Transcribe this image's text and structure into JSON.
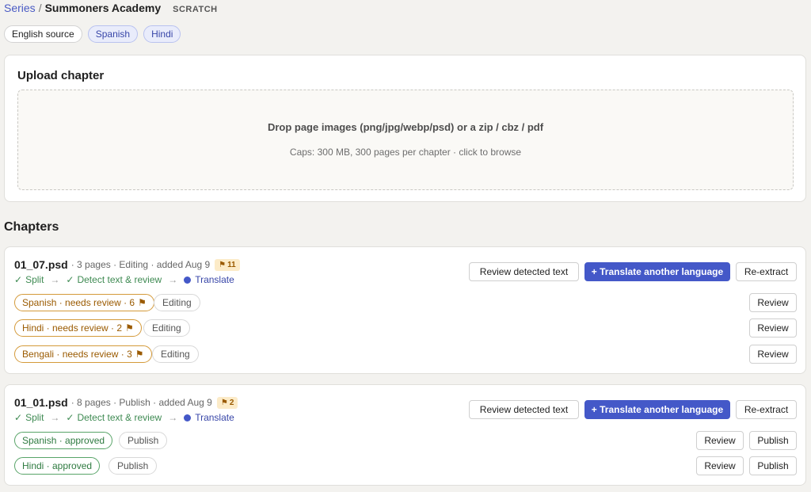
{
  "breadcrumb": {
    "link": "Series",
    "separator": "/",
    "series": "Summoners Academy",
    "tag": "SCRATCH"
  },
  "languages": {
    "source": "English source",
    "targets": [
      "Spanish",
      "Hindi"
    ]
  },
  "upload": {
    "title": "Upload chapter",
    "drop_text": "Drop page images (png/jpg/webp/psd) or a zip / cbz / pdf",
    "caps_text": "Caps: 300 MB, 300 pages per chapter · click to browse"
  },
  "chapters_title": "Chapters",
  "pipeline": {
    "split": "Split",
    "detect": "Detect text & review",
    "translate": "Translate",
    "arrow": "→",
    "check": "✓"
  },
  "buttons": {
    "review_detected": "Review detected text",
    "translate_another": "+ Translate another language",
    "reextract": "Re-extract",
    "review": "Review",
    "publish": "Publish"
  },
  "chapters": [
    {
      "name": "01_07.psd",
      "meta": "· 3 pages · Editing · added Aug 9",
      "flags": "11",
      "rows": [
        {
          "status": "Spanish · needs review · 6",
          "stage": "Editing"
        },
        {
          "status": "Hindi · needs review · 2",
          "stage": "Editing"
        },
        {
          "status": "Bengali · needs review · 3",
          "stage": "Editing"
        }
      ]
    },
    {
      "name": "01_01.psd",
      "meta": "· 8 pages · Publish · added Aug 9",
      "flags": "2",
      "rows": [
        {
          "status": "Spanish · approved",
          "stage": "Publish"
        },
        {
          "status": "Hindi · approved",
          "stage": "Publish"
        }
      ]
    }
  ],
  "icons": {
    "flag": "flag-icon",
    "check": "check-icon",
    "arrow": "arrow-right-icon",
    "current": "current-step-dot-icon"
  },
  "colors": {
    "accent": "#4458c8",
    "warning": "#d49a3a",
    "success": "#58a468",
    "flag_bg": "#fcebc8"
  }
}
